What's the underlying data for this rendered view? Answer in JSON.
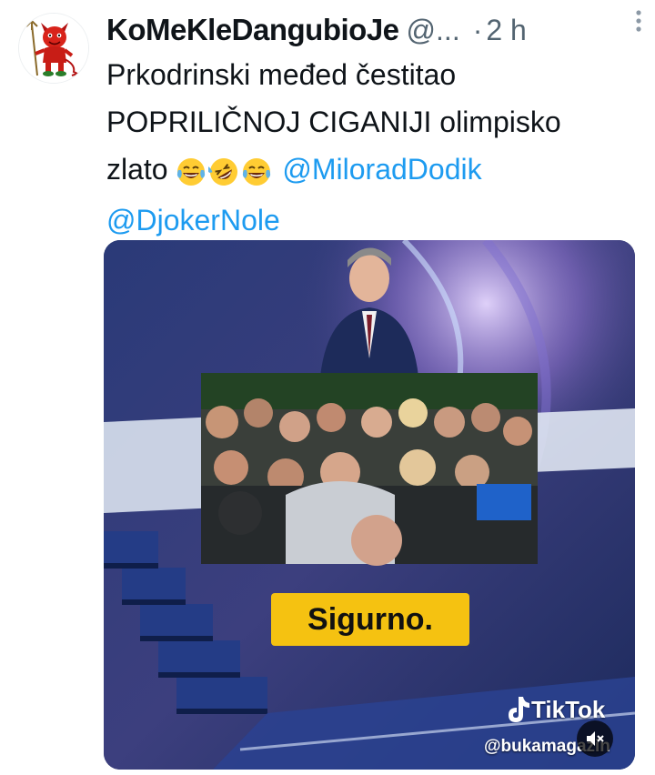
{
  "tweet": {
    "display_name": "KoMeKleDangubioJe",
    "handle": "@...",
    "separator": "·",
    "time": "2 h",
    "more_icon": "more-vertical-icon",
    "text_line1": "Prkodrinski međed čestitao",
    "text_line2": "POPRILIČNOJ CIGANIJI olimpisko",
    "text_line3_prefix": "zlato",
    "emojis": [
      "face-with-tears-of-joy",
      "rolling-on-floor-laughing",
      "face-with-tears-of-joy"
    ],
    "mentions": [
      "@MiloradDodik",
      "@DjokerNole"
    ]
  },
  "media": {
    "caption": "Sigurno.",
    "watermark_brand": "TikTok",
    "watermark_handle": "@bukamagazin",
    "mute_icon": "muted-speaker-icon"
  },
  "colors": {
    "accent": "#1d9bf0",
    "caption_bg": "#f5c211",
    "secondary_text": "#536471"
  }
}
